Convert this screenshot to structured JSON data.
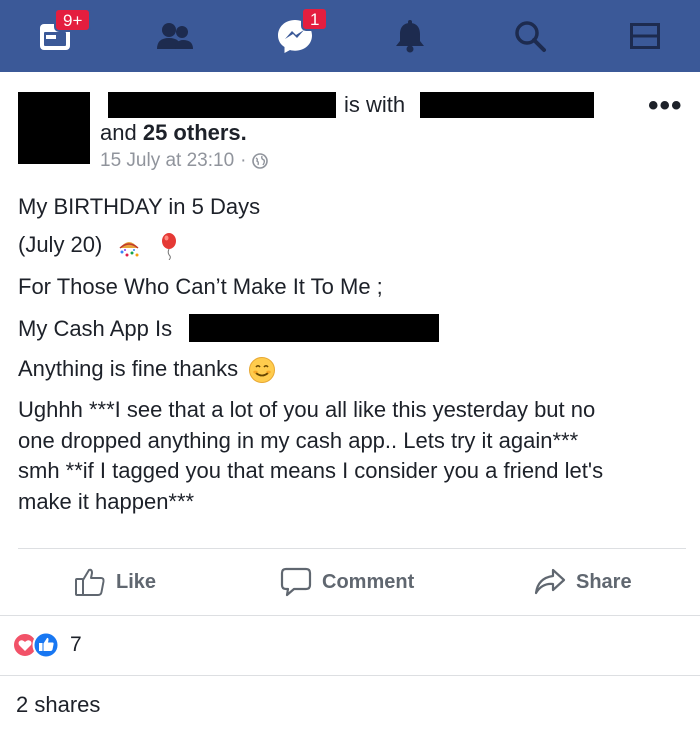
{
  "nav": {
    "items": [
      {
        "name": "requests-calendar-icon",
        "badge": "9+"
      },
      {
        "name": "friends-icon",
        "badge": ""
      },
      {
        "name": "messenger-icon",
        "badge": "1"
      },
      {
        "name": "notifications-bell-icon",
        "badge": ""
      },
      {
        "name": "search-icon",
        "badge": ""
      },
      {
        "name": "menu-icon",
        "badge": ""
      }
    ],
    "bar_color": "#3b5998",
    "badge_color": "#e41e3f"
  },
  "post": {
    "with_text": "is with",
    "others_prefix": "and",
    "others_count": "25 others.",
    "timestamp": "15 July at 23:10",
    "separator": "·",
    "lines": [
      "My BIRTHDAY in 5 Days",
      "(July 20)",
      "For Those Who Can’t Make It To Me ;",
      "My Cash App Is",
      "Anything is fine thanks",
      "Ughhh ***I see that a lot of you all like this yesterday but no",
      "one dropped anything in my cash app.. Lets try it again***",
      "smh **if I tagged you that means I consider you a friend let's",
      "make it happen***"
    ]
  },
  "actions": {
    "like": "Like",
    "comment": "Comment",
    "share": "Share"
  },
  "footer": {
    "reaction_count": "7",
    "shares": "2 shares"
  }
}
